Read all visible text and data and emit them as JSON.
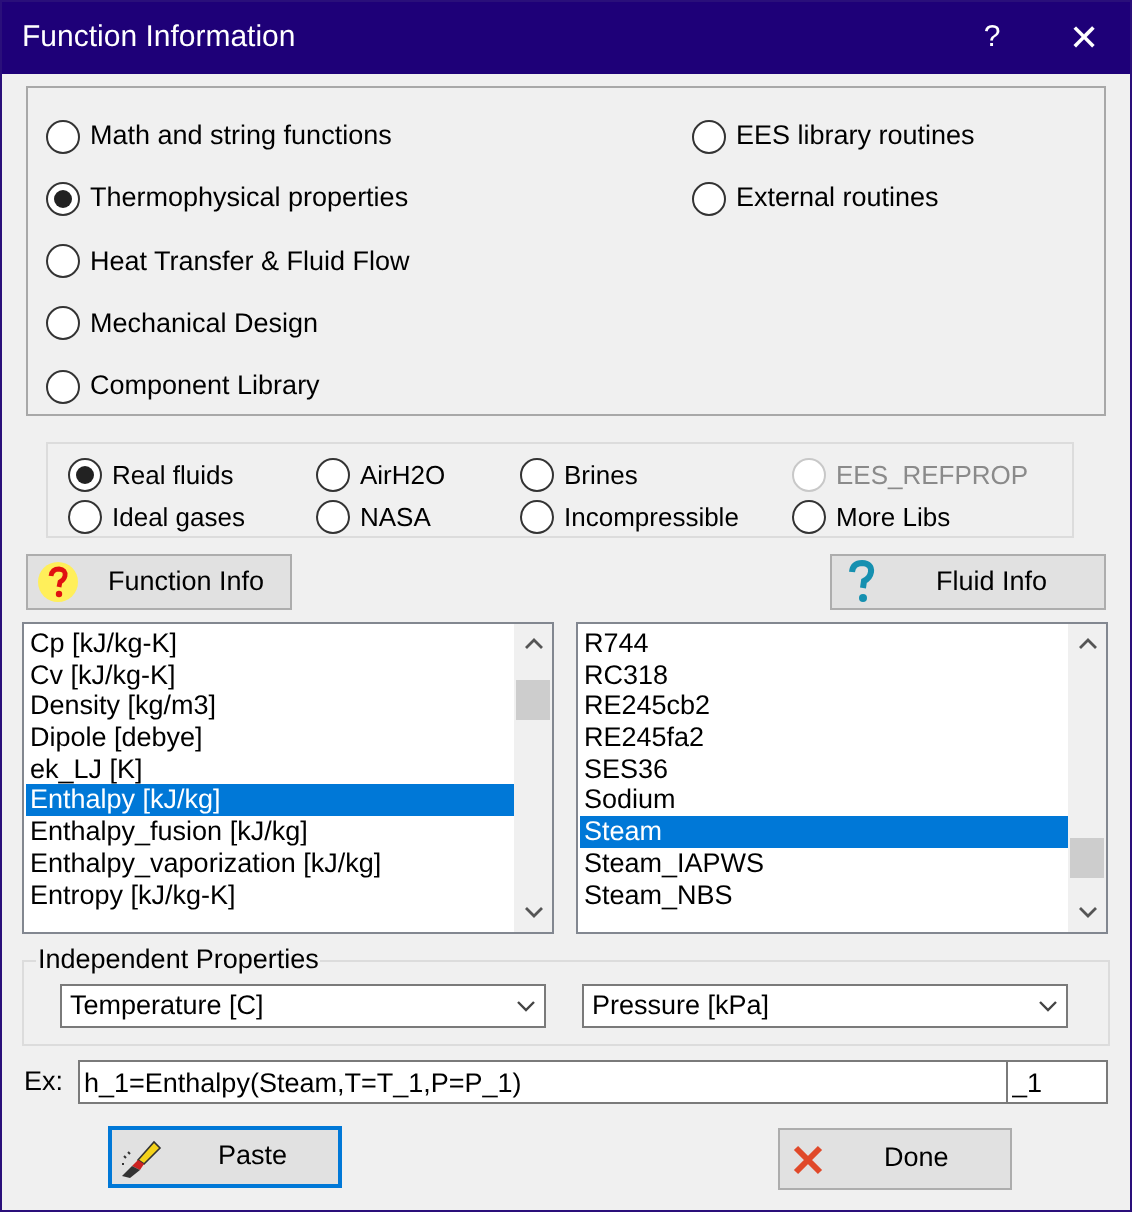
{
  "window": {
    "title": "Function Information",
    "help": "?",
    "close": "✕"
  },
  "categories": [
    {
      "label": "Math and string functions",
      "selected": false
    },
    {
      "label": "Thermophysical properties",
      "selected": true
    },
    {
      "label": "Heat Transfer & Fluid Flow",
      "selected": false
    },
    {
      "label": "Mechanical Design",
      "selected": false
    },
    {
      "label": "Component Library",
      "selected": false
    },
    {
      "label": "EES library routines",
      "selected": false
    },
    {
      "label": "External routines",
      "selected": false
    }
  ],
  "fluid_types": [
    {
      "label": "Real fluids",
      "selected": true,
      "disabled": false
    },
    {
      "label": "Ideal gases",
      "selected": false,
      "disabled": false
    },
    {
      "label": "AirH2O",
      "selected": false,
      "disabled": false
    },
    {
      "label": "NASA",
      "selected": false,
      "disabled": false
    },
    {
      "label": "Brines",
      "selected": false,
      "disabled": false
    },
    {
      "label": "Incompressible",
      "selected": false,
      "disabled": false
    },
    {
      "label": "EES_REFPROP",
      "selected": false,
      "disabled": true
    },
    {
      "label": "More Libs",
      "selected": false,
      "disabled": false
    }
  ],
  "function_info_button": "Function Info",
  "fluid_info_button": "Fluid Info",
  "functions": [
    {
      "label": "Cp [kJ/kg-K]",
      "selected": false
    },
    {
      "label": "Cv [kJ/kg-K]",
      "selected": false
    },
    {
      "label": "Density [kg/m3]",
      "selected": false
    },
    {
      "label": "Dipole [debye]",
      "selected": false
    },
    {
      "label": "ek_LJ [K]",
      "selected": false
    },
    {
      "label": "Enthalpy [kJ/kg]",
      "selected": true
    },
    {
      "label": "Enthalpy_fusion [kJ/kg]",
      "selected": false
    },
    {
      "label": "Enthalpy_vaporization [kJ/kg]",
      "selected": false
    },
    {
      "label": "Entropy [kJ/kg-K]",
      "selected": false
    }
  ],
  "fluids": [
    {
      "label": "R744",
      "selected": false
    },
    {
      "label": "RC318",
      "selected": false
    },
    {
      "label": "RE245cb2",
      "selected": false
    },
    {
      "label": "RE245fa2",
      "selected": false
    },
    {
      "label": "SES36",
      "selected": false
    },
    {
      "label": "Sodium",
      "selected": false
    },
    {
      "label": "Steam",
      "selected": true
    },
    {
      "label": "Steam_IAPWS",
      "selected": false
    },
    {
      "label": "Steam_NBS",
      "selected": false
    }
  ],
  "independent_properties": {
    "title": "Independent Properties",
    "property_1": "Temperature [C]",
    "property_2": "Pressure [kPa]"
  },
  "example": {
    "label": "Ex:",
    "value": "h_1=Enthalpy(Steam,T=T_1,P=P_1)",
    "suffix": "_1"
  },
  "buttons": [
    {
      "label": "Paste",
      "kind": "paste"
    },
    {
      "label": "Done",
      "kind": "done"
    }
  ]
}
